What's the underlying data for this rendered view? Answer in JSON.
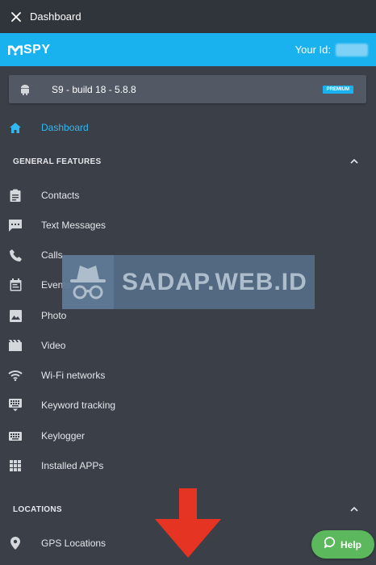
{
  "topbar": {
    "title": "Dashboard",
    "close_icon": "close-icon"
  },
  "brand": {
    "logo_text": "SPY",
    "id_label": "Your Id:",
    "color": "#1ab2ee"
  },
  "device": {
    "name": "S9 - build 18 - 5.8.8",
    "badge": "PREMIUM",
    "icon": "android-icon"
  },
  "nav": {
    "dashboard": {
      "label": "Dashboard",
      "icon": "home-icon"
    }
  },
  "general_features": {
    "title": "GENERAL FEATURES",
    "items": [
      {
        "label": "Contacts",
        "icon": "clipboard-icon"
      },
      {
        "label": "Text Messages",
        "icon": "chat-icon"
      },
      {
        "label": "Calls",
        "icon": "phone-icon"
      },
      {
        "label": "Events",
        "icon": "calendar-icon"
      },
      {
        "label": "Photo",
        "icon": "image-icon"
      },
      {
        "label": "Video",
        "icon": "film-icon"
      },
      {
        "label": "Wi-Fi networks",
        "icon": "wifi-icon"
      },
      {
        "label": "Keyword tracking",
        "icon": "keyboard-icon"
      },
      {
        "label": "Keylogger",
        "icon": "keyboard-icon"
      },
      {
        "label": "Installed APPs",
        "icon": "apps-grid-icon"
      }
    ]
  },
  "locations": {
    "title": "LOCATIONS",
    "items": [
      {
        "label": "GPS Locations",
        "icon": "location-pin-icon"
      }
    ]
  },
  "watermark": {
    "text": "SADAP.WEB.ID"
  },
  "help": {
    "label": "Help"
  },
  "colors": {
    "sidebar_bg": "#3a3f48",
    "topbar_bg": "#30343b",
    "accent": "#1ab2ee",
    "help_green": "#5cb85c",
    "arrow_red": "#e53422"
  }
}
